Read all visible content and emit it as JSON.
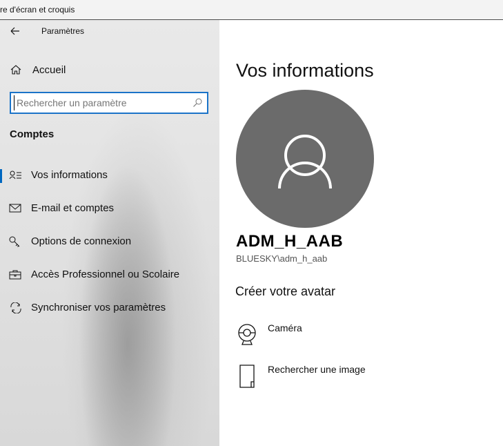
{
  "background_window": {
    "title": "re d'écran et croquis"
  },
  "app": {
    "title": "Paramètres"
  },
  "sidebar": {
    "home_label": "Accueil",
    "search": {
      "placeholder": "Rechercher un paramètre",
      "value": ""
    },
    "group_title": "Comptes",
    "items": [
      {
        "label": "Vos informations",
        "icon": "user-info-icon",
        "selected": true
      },
      {
        "label": "E-mail et comptes",
        "icon": "mail-icon",
        "selected": false
      },
      {
        "label": "Options de connexion",
        "icon": "key-icon",
        "selected": false
      },
      {
        "label": "Accès Professionnel ou Scolaire",
        "icon": "briefcase-icon",
        "selected": false
      },
      {
        "label": "Synchroniser vos paramètres",
        "icon": "sync-icon",
        "selected": false
      }
    ]
  },
  "main": {
    "title": "Vos informations",
    "user": {
      "name": "ADM_H_AAB",
      "account": "BLUESKY\\adm_h_aab"
    },
    "avatar_section_title": "Créer votre avatar",
    "actions": [
      {
        "label": "Caméra",
        "icon": "camera-icon"
      },
      {
        "label": "Rechercher une image",
        "icon": "file-icon"
      }
    ]
  },
  "colors": {
    "accent": "#0067c0",
    "search_border": "#1a73c8",
    "avatar_bg": "#6b6b6b"
  }
}
